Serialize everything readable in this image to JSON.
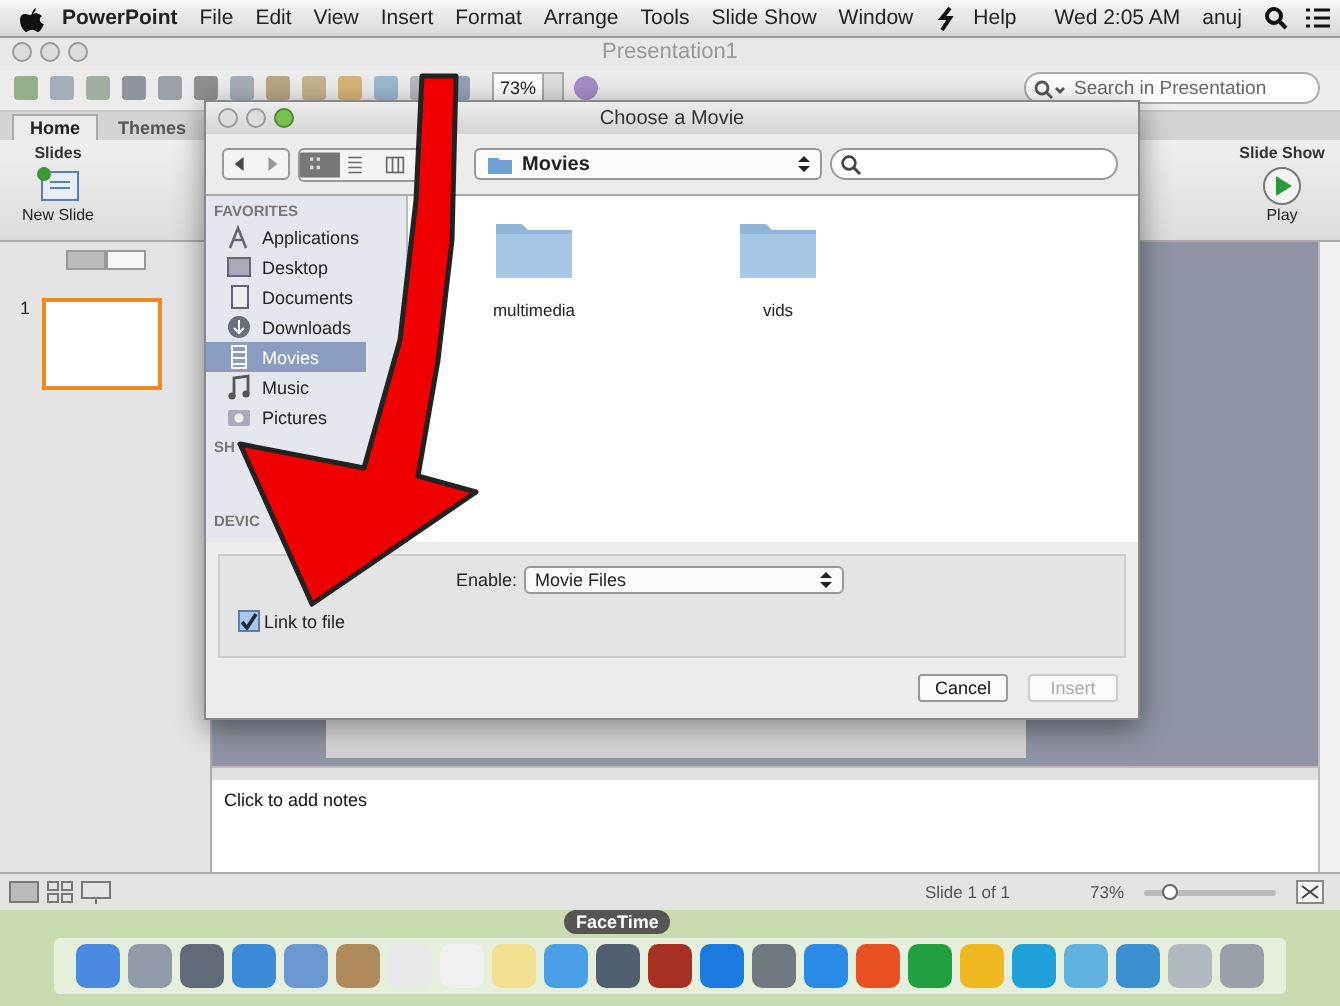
{
  "menu_bar": {
    "app_name": "PowerPoint",
    "items": [
      "File",
      "Edit",
      "View",
      "Insert",
      "Format",
      "Arrange",
      "Tools",
      "Slide Show",
      "Window",
      "Help"
    ],
    "clock": "Wed 2:05 AM",
    "user": "anuj"
  },
  "window": {
    "title": "Presentation1"
  },
  "toolbar": {
    "zoom": "73%",
    "search": {
      "placeholder": "Search in Presentation"
    }
  },
  "ribbon": {
    "tabs": [
      {
        "label": "Home",
        "selected": true
      },
      {
        "label": "Themes",
        "selected": false
      }
    ],
    "groups": [
      {
        "title": "Slides",
        "button": "New Slide"
      },
      {
        "title": "Slide Show",
        "button": "Play"
      }
    ]
  },
  "slides_pane": {
    "thumbnails": [
      {
        "number": "1",
        "selected": true
      }
    ]
  },
  "notes": {
    "placeholder": "Click to add notes"
  },
  "status_bar": {
    "slide_info": "Slide 1 of 1",
    "zoom": "73%",
    "zoom_slider": {
      "level": 0.2
    }
  },
  "dock": {
    "tooltip": "FaceTime"
  },
  "dialog": {
    "title": "Choose a Movie",
    "location": "Movies",
    "view_modes": [
      {
        "kind": "icons",
        "selected": true
      },
      {
        "kind": "list",
        "selected": false
      },
      {
        "kind": "columns",
        "selected": false
      }
    ],
    "sidebar": [
      {
        "heading": "FAVORITES",
        "items": [
          {
            "label": "Applications",
            "selected": false
          },
          {
            "label": "Desktop",
            "selected": false
          },
          {
            "label": "Documents",
            "selected": false
          },
          {
            "label": "Downloads",
            "selected": false
          },
          {
            "label": "Movies",
            "selected": true
          },
          {
            "label": "Music",
            "selected": false
          },
          {
            "label": "Pictures",
            "selected": false
          }
        ]
      },
      {
        "heading": "SH"
      },
      {
        "heading": "DEVIC"
      }
    ],
    "files": [
      {
        "name": "multimedia"
      },
      {
        "name": "vids"
      }
    ],
    "enable_label": "Enable:",
    "enable_value": "Movie Files",
    "link_to_file": {
      "label": "Link to file",
      "checked": true
    },
    "buttons": [
      {
        "label": "Cancel",
        "disabled": false
      },
      {
        "label": "Insert",
        "disabled": true
      }
    ]
  }
}
